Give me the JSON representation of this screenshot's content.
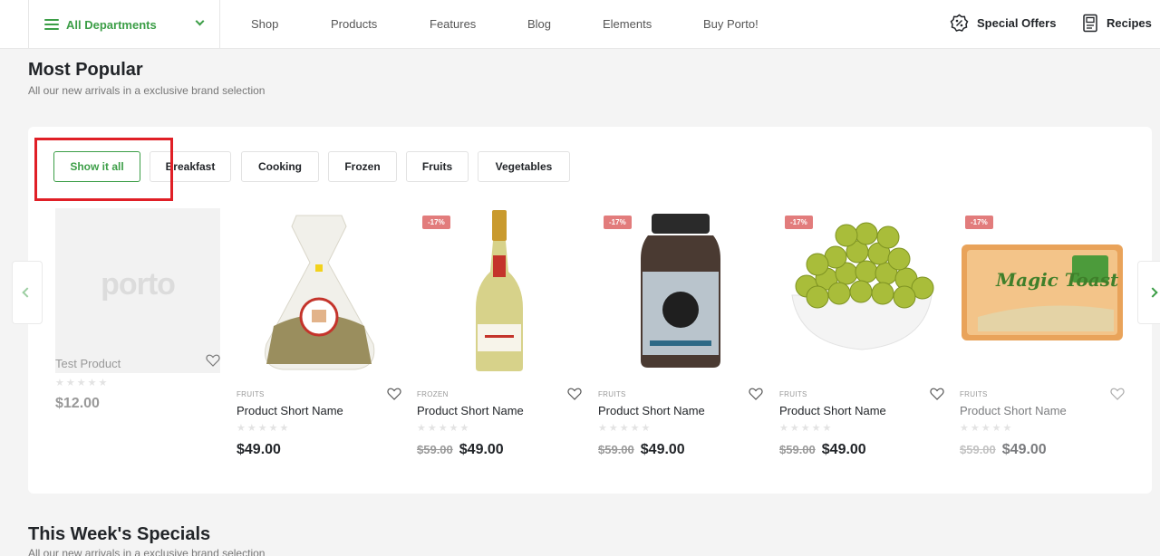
{
  "nav": {
    "departments_label": "All Departments",
    "items": [
      "Shop",
      "Products",
      "Features",
      "Blog",
      "Elements",
      "Buy Porto!"
    ],
    "special_offers": "Special Offers",
    "recipes": "Recipes"
  },
  "most_popular": {
    "title": "Most Popular",
    "subtitle": "All our new arrivals in a exclusive brand selection",
    "filters": [
      "Show it all",
      "Breakfast",
      "Cooking",
      "Frozen",
      "Fruits",
      "Vegetables"
    ],
    "active_filter": "Show it all"
  },
  "products": [
    {
      "category": "",
      "name": "Test Product",
      "old_price": "",
      "price": "$12.00",
      "badge": "",
      "image": "porto-placeholder"
    },
    {
      "category": "FRUITS",
      "name": "Product Short Name",
      "old_price": "",
      "price": "$49.00",
      "badge": "",
      "image": "herb-bag"
    },
    {
      "category": "FROZEN",
      "name": "Product Short Name",
      "old_price": "$59.00",
      "price": "$49.00",
      "badge": "-17%",
      "image": "champagne-bottle"
    },
    {
      "category": "FRUITS",
      "name": "Product Short Name",
      "old_price": "$59.00",
      "price": "$49.00",
      "badge": "-17%",
      "image": "coffee-jar"
    },
    {
      "category": "FRUITS",
      "name": "Product Short Name",
      "old_price": "$59.00",
      "price": "$49.00",
      "badge": "-17%",
      "image": "grapes-bowl"
    },
    {
      "category": "FRUITS",
      "name": "Product Short Name",
      "old_price": "$59.00",
      "price": "$49.00",
      "badge": "-17%",
      "image": "toast-pack"
    }
  ],
  "stars": "★★★★★",
  "placeholder_logo": "porto",
  "toast_brand": "Magic Toast",
  "weekly": {
    "title": "This Week's Specials",
    "subtitle": "All our new arrivals in a exclusive brand selection"
  },
  "colors": {
    "accent": "#3c9e47",
    "badge": "#e27c7c",
    "highlight": "#e01f26"
  }
}
